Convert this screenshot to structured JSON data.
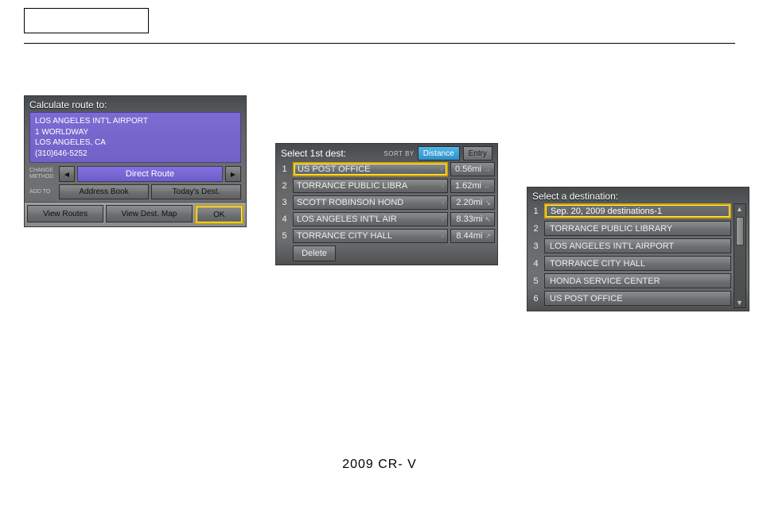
{
  "footer": "2009  CR- V",
  "panel1": {
    "title": "Calculate route to:",
    "dest": {
      "name": "LOS ANGELES INT'L AIRPORT",
      "addr1": "1 WORLDWAY",
      "city": "LOS ANGELES, CA",
      "phone": "(310)646-5252"
    },
    "change_method_label": "CHANGE METHOD",
    "route_mode": "Direct Route",
    "addto_label": "ADD TO",
    "address_book": "Address Book",
    "todays_dest": "Today's Dest.",
    "view_routes": "View Routes",
    "view_dest_map": "View Dest. Map",
    "ok": "OK"
  },
  "panel2": {
    "title": "Select 1st dest:",
    "sort_by_label": "SORT BY",
    "tab_distance": "Distance",
    "tab_entry": "Entry",
    "items": [
      {
        "n": "1",
        "name": "US POST OFFICE",
        "dist": "0.56mi",
        "selected": true
      },
      {
        "n": "2",
        "name": "TORRANCE PUBLIC LIBRA",
        "dist": "1.62mi",
        "selected": false
      },
      {
        "n": "3",
        "name": "SCOTT ROBINSON HOND",
        "dist": "2.20mi",
        "selected": false
      },
      {
        "n": "4",
        "name": "LOS ANGELES INT'L AIR",
        "dist": "8.33mi",
        "selected": false
      },
      {
        "n": "5",
        "name": "TORRANCE CITY HALL",
        "dist": "8.44mi",
        "selected": false
      }
    ],
    "delete": "Delete"
  },
  "panel3": {
    "title": "Select a destination:",
    "items": [
      {
        "n": "1",
        "name": "Sep. 20, 2009 destinations-1",
        "selected": true
      },
      {
        "n": "2",
        "name": "TORRANCE PUBLIC LIBRARY",
        "selected": false
      },
      {
        "n": "3",
        "name": "LOS ANGELES INT'L AIRPORT",
        "selected": false
      },
      {
        "n": "4",
        "name": "TORRANCE CITY HALL",
        "selected": false
      },
      {
        "n": "5",
        "name": "HONDA SERVICE CENTER",
        "selected": false
      },
      {
        "n": "6",
        "name": "US POST OFFICE",
        "selected": false
      }
    ]
  }
}
